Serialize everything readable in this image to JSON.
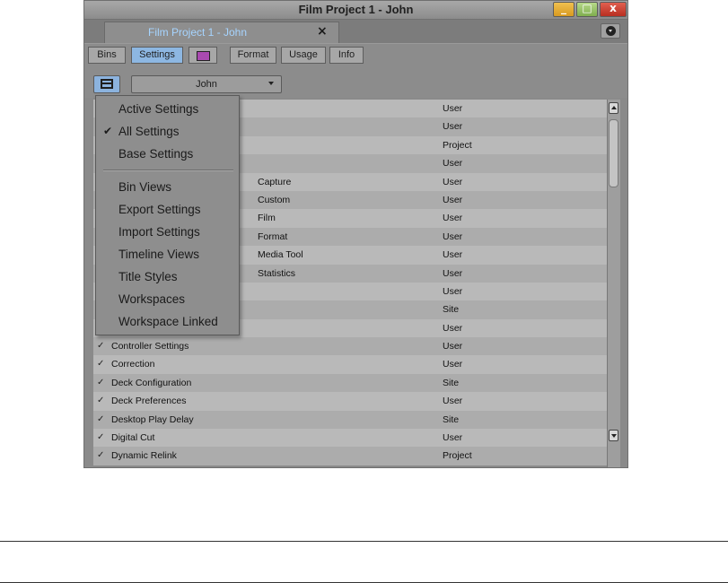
{
  "window": {
    "title": "Film Project 1 - John",
    "controls": {
      "minimize": "_",
      "maximize": "□",
      "close": "x"
    }
  },
  "project_tab": {
    "label": "Film Project 1 - John",
    "close": "×"
  },
  "tabs": [
    {
      "label": "Bins"
    },
    {
      "label": "Settings"
    },
    {
      "label": ""
    },
    {
      "label": "Format"
    },
    {
      "label": "Usage"
    },
    {
      "label": "Info"
    }
  ],
  "toolbar": {
    "user_select": "John"
  },
  "settings": [
    {
      "name": "",
      "sub": "",
      "kind": "User"
    },
    {
      "name": "",
      "sub": "",
      "kind": "User"
    },
    {
      "name": "",
      "sub": "",
      "kind": "Project"
    },
    {
      "name": "",
      "sub": "",
      "kind": "User"
    },
    {
      "name": "",
      "sub": "Capture",
      "kind": "User"
    },
    {
      "name": "",
      "sub": "Custom",
      "kind": "User"
    },
    {
      "name": "",
      "sub": "Film",
      "kind": "User"
    },
    {
      "name": "",
      "sub": "Format",
      "kind": "User"
    },
    {
      "name": "",
      "sub": "Media Tool",
      "kind": "User"
    },
    {
      "name": "",
      "sub": "Statistics",
      "kind": "User"
    },
    {
      "name": "",
      "sub": "",
      "kind": "User"
    },
    {
      "name": "",
      "sub": "",
      "kind": "Site"
    },
    {
      "name": "",
      "sub": "",
      "kind": "User"
    },
    {
      "name": "Controller Settings",
      "sub": "",
      "kind": "User"
    },
    {
      "name": "Correction",
      "sub": "",
      "kind": "User"
    },
    {
      "name": "Deck Configuration",
      "sub": "",
      "kind": "Site"
    },
    {
      "name": "Deck Preferences",
      "sub": "",
      "kind": "User"
    },
    {
      "name": "Desktop Play Delay",
      "sub": "",
      "kind": "Site"
    },
    {
      "name": "Digital Cut",
      "sub": "",
      "kind": "User"
    },
    {
      "name": "Dynamic Relink",
      "sub": "",
      "kind": "Project"
    }
  ],
  "check_glyph": "✓",
  "dropdown": {
    "items": [
      {
        "label": "Active Settings",
        "checked": false
      },
      {
        "label": "All Settings",
        "checked": true
      },
      {
        "label": "Base Settings",
        "checked": false
      },
      {
        "label": "Bin Views",
        "checked": false
      },
      {
        "label": "Export Settings",
        "checked": false
      },
      {
        "label": "Import Settings",
        "checked": false
      },
      {
        "label": "Timeline Views",
        "checked": false
      },
      {
        "label": "Title Styles",
        "checked": false
      },
      {
        "label": "Workspaces",
        "checked": false
      },
      {
        "label": "Workspace Linked",
        "checked": false
      }
    ],
    "check_glyph": "✔"
  },
  "colors": {
    "active_tab": "#8db7e2",
    "project_label": "#a6d4ff"
  }
}
